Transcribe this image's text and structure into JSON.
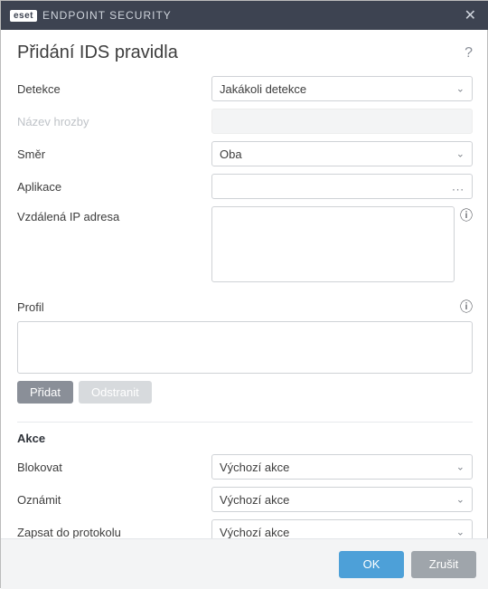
{
  "titlebar": {
    "brand_badge": "eset",
    "brand_text": "ENDPOINT SECURITY"
  },
  "header": {
    "title": "Přidání IDS pravidla"
  },
  "fields": {
    "detekce": {
      "label": "Detekce",
      "value": "Jakákoli detekce"
    },
    "nazev_hrozby": {
      "label": "Název hrozby"
    },
    "smer": {
      "label": "Směr",
      "value": "Oba"
    },
    "aplikace": {
      "label": "Aplikace",
      "value": ""
    },
    "vzdalena_ip": {
      "label": "Vzdálená IP adresa",
      "value": ""
    },
    "profil": {
      "label": "Profil"
    }
  },
  "profil_buttons": {
    "add": "Přidat",
    "remove": "Odstranit"
  },
  "akce": {
    "section": "Akce",
    "blokovat": {
      "label": "Blokovat",
      "value": "Výchozí akce"
    },
    "oznamit": {
      "label": "Oznámit",
      "value": "Výchozí akce"
    },
    "zapsat": {
      "label": "Zapsat do protokolu",
      "value": "Výchozí akce"
    }
  },
  "footer": {
    "ok": "OK",
    "cancel": "Zrušit"
  }
}
